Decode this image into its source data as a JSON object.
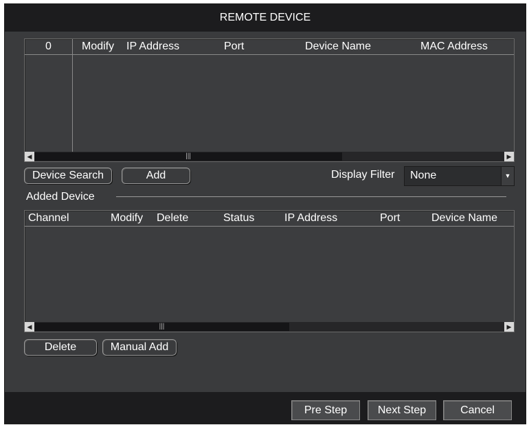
{
  "window": {
    "title": "REMOTE DEVICE"
  },
  "search_table": {
    "columns": [
      "0",
      "Modify",
      "IP Address",
      "Port",
      "Device Name",
      "MAC Address"
    ],
    "rows": []
  },
  "buttons": {
    "device_search": "Device Search",
    "add": "Add",
    "delete": "Delete",
    "manual_add": "Manual Add"
  },
  "display_filter": {
    "label": "Display Filter",
    "value": "None"
  },
  "added_device": {
    "label": "Added Device",
    "columns": [
      "Channel",
      "Modify",
      "Delete",
      "Status",
      "IP Address",
      "Port",
      "Device Name"
    ],
    "rows": []
  },
  "footer": {
    "pre_step": "Pre Step",
    "next_step": "Next Step",
    "cancel": "Cancel"
  },
  "icons": {
    "scroll_left": "scroll-left-arrow-icon",
    "scroll_right": "scroll-right-arrow-icon",
    "dropdown": "dropdown-arrow-icon",
    "grip": "scroll-grip-icon"
  }
}
